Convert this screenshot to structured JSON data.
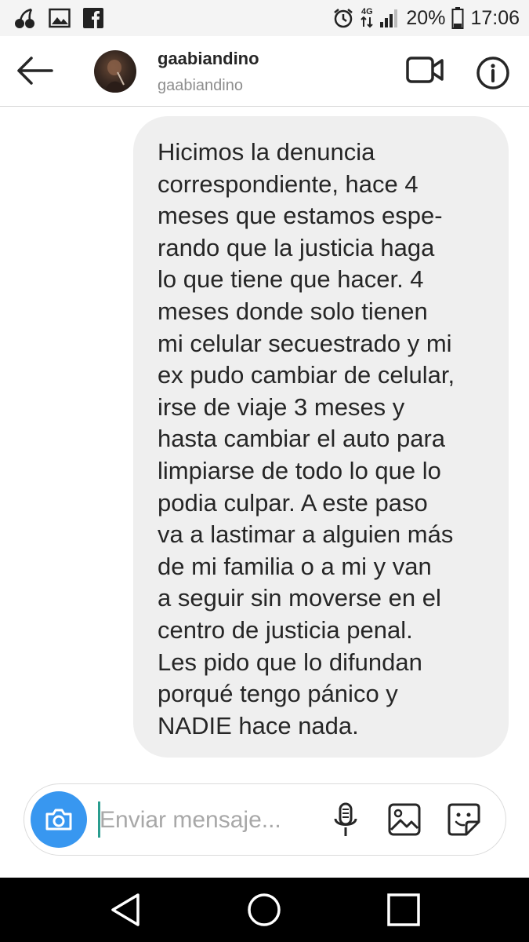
{
  "status_bar": {
    "notification_icons": [
      "cherries-icon",
      "image-icon",
      "facebook-icon"
    ],
    "network_label": "4G",
    "battery": "20%",
    "time": "17:06"
  },
  "header": {
    "title": "gaabiandino",
    "subtitle": "gaabiandino"
  },
  "message": {
    "text": "Hicimos la denuncia\ncorrespondiente, hace 4\nmeses que estamos espe-\nrando que la justicia haga\nlo que tiene que hacer. 4\nmeses donde solo tienen\nmi celular secuestrado y mi\nex pudo cambiar de celular,\nirse de viaje 3 meses y\nhasta cambiar el auto para\nlimpiarse de todo lo que lo\npodia culpar. A este paso\nva a lastimar a alguien más\nde mi familia o a mi y van\na seguir sin moverse en el\ncentro de justicia penal.\nLes pido que lo difundan\nporqué tengo pánico y\nNADIE hace nada."
  },
  "composer": {
    "placeholder": "Enviar mensaje..."
  },
  "colors": {
    "accent": "#3897f0",
    "bubble": "#efefef",
    "status_bar_bg": "#f4f4f4",
    "nav_bar_bg": "#000000"
  }
}
